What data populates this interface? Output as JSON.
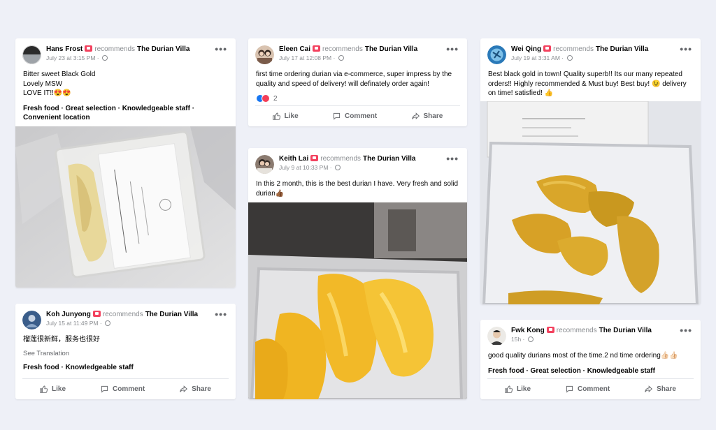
{
  "common": {
    "recommends": "recommends",
    "page_name": "The Durian Villa",
    "like": "Like",
    "comment": "Comment",
    "share": "Share",
    "more": "•••"
  },
  "posts": [
    {
      "user": "Hans Frost",
      "date": "July 23 at 3:15 PM",
      "lines": [
        "Bitter sweet Black Gold",
        "Lovely MSW",
        "LOVE IT!!😍😍"
      ],
      "tags_line1": "Fresh food · Great selection · Knowledgeable staff ·",
      "tags_line2": "Convenient location"
    },
    {
      "user": "Koh Junyong",
      "date": "July 15 at 11:49 PM",
      "text": "榴莲很新鲜，服务也很好",
      "see_translation": "See Translation",
      "tags": "Fresh food · Knowledgeable staff"
    },
    {
      "user": "Eleen Cai",
      "date": "July 17 at 12:08 PM",
      "text": "first time ordering durian via e-commerce, super impress by the quality and speed of delivery! will definately order again!",
      "reaction_count": "2"
    },
    {
      "user": "Keith Lai",
      "date": "July 9 at 10:33 PM",
      "text": "In this 2 month, this is the best durian I have. Very fresh and solid durian👍🏾"
    },
    {
      "user": "Wei Qing",
      "date": "July 19 at 3:31 AM",
      "text": "Best black gold in town! Quality superb!! Its our many repeated orders!! Highly recommended & Must buy!  Best buy! 😉 delivery on time! satisfied! 👍"
    },
    {
      "user": "Fwk Kong",
      "date": "15h",
      "text": "good quality durians most of the time.2 nd time ordering👍🏻👍🏻",
      "tags": "Fresh food · Great selection · Knowledgeable staff"
    }
  ]
}
